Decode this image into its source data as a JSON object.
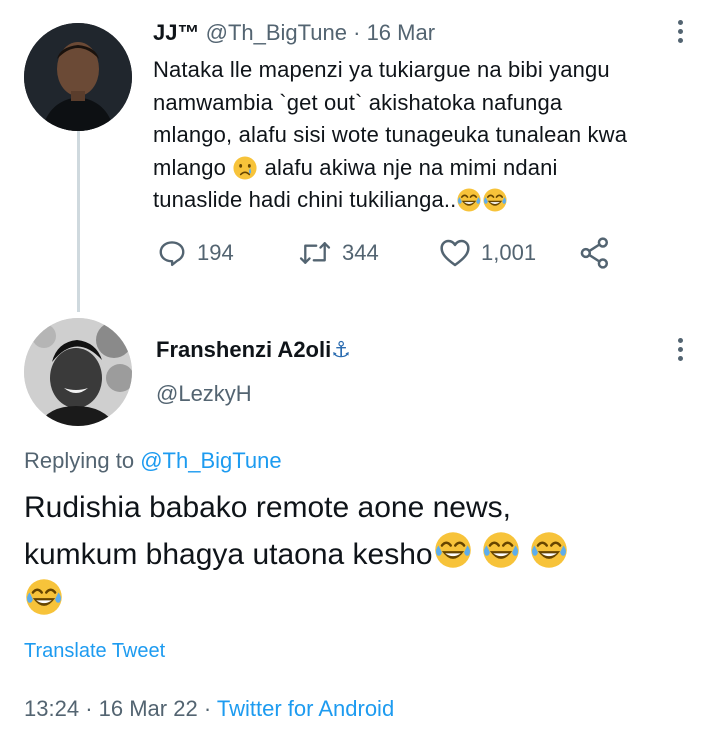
{
  "parent_tweet": {
    "author_name": "JJ™",
    "handle": "@Th_BigTune",
    "separator": "·",
    "date": "16 Mar",
    "text_lines": [
      "Nataka lle mapenzi  ya tukiargue na bibi yangu",
      "namwambia `get out` akishatoka nafunga",
      "mlango, alafu sisi wote tunageuka tunalean kwa",
      "mlango",
      "alafu akiwa nje na mimi ndani",
      "tunaslide hadi chini tukilianga.."
    ],
    "reply_count": "194",
    "retweet_count": "344",
    "like_count": "1,001"
  },
  "reply_tweet": {
    "author_name": "Franshenzi A2oli",
    "author_emoji": "⚓",
    "handle": "@LezkyH",
    "replying_prefix": "Replying to",
    "replying_to": "@Th_BigTune",
    "text_line1": "Rudishia babako remote aone news,",
    "text_line2": "kumkum bhagya utaona kesho",
    "translate_label": "Translate Tweet",
    "time": "13:24",
    "dot": "·",
    "date": "16 Mar 22",
    "source": "Twitter for Android"
  },
  "icons": {
    "reply": "reply-icon",
    "retweet": "retweet-icon",
    "like": "heart-icon",
    "share": "share-icon",
    "more": "more-vertical-icon",
    "crying": "crying-face-emoji",
    "laughing": "tears-of-joy-emoji"
  },
  "colors": {
    "link": "#1d9bf0",
    "muted": "#536471",
    "text": "#0f1419",
    "thread_line": "#cfd9de"
  }
}
